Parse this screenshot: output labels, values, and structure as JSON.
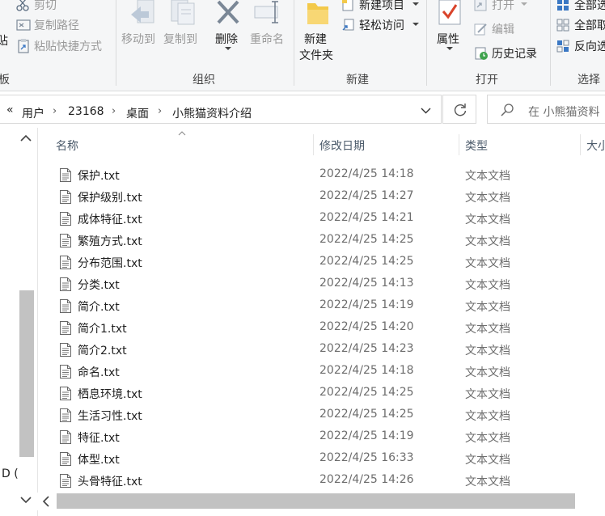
{
  "ribbon": {
    "clipboard_partial_label": "板",
    "clipboard_paste_partial": "贴",
    "cut_label": "剪切",
    "copy_path_label": "复制路径",
    "paste_shortcut_label": "粘贴快捷方式",
    "move_to_label": "移动到",
    "copy_to_label": "复制到",
    "delete_label": "删除",
    "rename_label": "重命名",
    "organize_group": "组织",
    "new_folder_line1": "新建",
    "new_folder_line2": "文件夹",
    "new_item_label": "新建项目",
    "easy_access_label": "轻松访问",
    "new_group": "新建",
    "properties_label": "属性",
    "open_label": "打开",
    "edit_label": "编辑",
    "history_label": "历史记录",
    "open_group": "打开",
    "select_all_label": "全部选",
    "select_none_label": "全部取",
    "invert_selection_label": "反向选",
    "select_group": "选择"
  },
  "address": {
    "overflow": "«",
    "crumbs": [
      "用户",
      "23168",
      "桌面",
      "小熊猫资料介绍"
    ],
    "search_placeholder": "在 小熊猫资料"
  },
  "nav": {
    "partial_item": "D ("
  },
  "columns": {
    "name": "名称",
    "date": "修改日期",
    "type": "类型",
    "size": "大小"
  },
  "files": [
    {
      "name": "保护.txt",
      "date": "2022/4/25 14:18",
      "type": "文本文档"
    },
    {
      "name": "保护级别.txt",
      "date": "2022/4/25 14:27",
      "type": "文本文档"
    },
    {
      "name": "成体特征.txt",
      "date": "2022/4/25 14:21",
      "type": "文本文档"
    },
    {
      "name": "繁殖方式.txt",
      "date": "2022/4/25 14:25",
      "type": "文本文档"
    },
    {
      "name": "分布范围.txt",
      "date": "2022/4/25 14:25",
      "type": "文本文档"
    },
    {
      "name": "分类.txt",
      "date": "2022/4/25 14:13",
      "type": "文本文档"
    },
    {
      "name": "简介.txt",
      "date": "2022/4/25 14:19",
      "type": "文本文档"
    },
    {
      "name": "简介1.txt",
      "date": "2022/4/25 14:20",
      "type": "文本文档"
    },
    {
      "name": "简介2.txt",
      "date": "2022/4/25 14:23",
      "type": "文本文档"
    },
    {
      "name": "命名.txt",
      "date": "2022/4/25 14:18",
      "type": "文本文档"
    },
    {
      "name": "栖息环境.txt",
      "date": "2022/4/25 14:25",
      "type": "文本文档"
    },
    {
      "name": "生活习性.txt",
      "date": "2022/4/25 14:25",
      "type": "文本文档"
    },
    {
      "name": "特征.txt",
      "date": "2022/4/25 14:19",
      "type": "文本文档"
    },
    {
      "name": "体型.txt",
      "date": "2022/4/25 16:33",
      "type": "文本文档"
    },
    {
      "name": "头骨特征.txt",
      "date": "2022/4/25 14:26",
      "type": "文本文档"
    }
  ]
}
